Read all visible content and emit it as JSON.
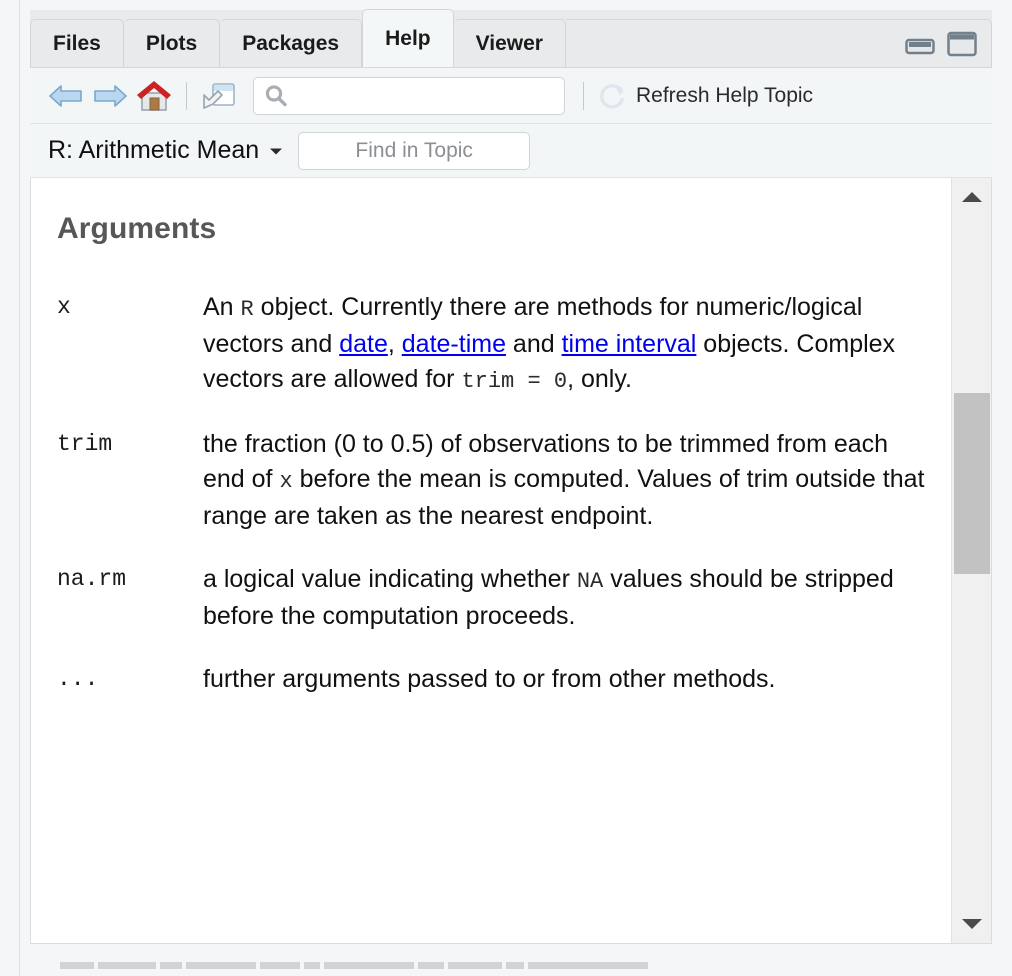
{
  "window": {
    "tabs": [
      {
        "label": "Files",
        "active": false
      },
      {
        "label": "Plots",
        "active": false
      },
      {
        "label": "Packages",
        "active": false
      },
      {
        "label": "Help",
        "active": true
      },
      {
        "label": "Viewer",
        "active": false
      }
    ],
    "controls": {
      "minimize": "minimize-icon",
      "maximize": "maximize-icon"
    }
  },
  "toolbar": {
    "back_icon": "back-arrow-icon",
    "forward_icon": "forward-arrow-icon",
    "home_icon": "home-icon",
    "popout_icon": "show-in-new-window-icon",
    "search": {
      "icon": "search-icon",
      "value": "",
      "placeholder": ""
    },
    "refresh": {
      "icon": "refresh-icon",
      "label": "Refresh Help Topic"
    }
  },
  "topicbar": {
    "title": "R: Arithmetic Mean",
    "caret_icon": "chevron-down-icon",
    "find": {
      "value": "",
      "placeholder": "Find in Topic"
    }
  },
  "content": {
    "heading": "Arguments",
    "arguments": [
      {
        "name": "x",
        "parts": [
          {
            "t": "text",
            "v": "An "
          },
          {
            "t": "code",
            "v": "R"
          },
          {
            "t": "text",
            "v": " object. Currently there are methods for numeric/logical vectors and "
          },
          {
            "t": "link",
            "v": "date"
          },
          {
            "t": "text",
            "v": ", "
          },
          {
            "t": "link",
            "v": "date-time"
          },
          {
            "t": "text",
            "v": " and "
          },
          {
            "t": "link",
            "v": "time interval"
          },
          {
            "t": "text",
            "v": " objects. Complex vectors are allowed for "
          },
          {
            "t": "code",
            "v": "trim = 0"
          },
          {
            "t": "text",
            "v": ", only."
          }
        ]
      },
      {
        "name": "trim",
        "parts": [
          {
            "t": "text",
            "v": "the fraction (0 to 0.5) of observations to be trimmed from each end of "
          },
          {
            "t": "code",
            "v": "x"
          },
          {
            "t": "text",
            "v": " before the mean is computed. Values of trim outside that range are taken as the nearest endpoint."
          }
        ]
      },
      {
        "name": "na.rm",
        "parts": [
          {
            "t": "text",
            "v": "a logical value indicating whether "
          },
          {
            "t": "code",
            "v": "NA"
          },
          {
            "t": "text",
            "v": " values should be stripped before the computation proceeds."
          }
        ]
      },
      {
        "name": "...",
        "parts": [
          {
            "t": "text",
            "v": "further arguments passed to or from other methods."
          }
        ]
      }
    ]
  },
  "scrollbar": {
    "up_icon": "scroll-up-arrow-icon",
    "down_icon": "scroll-down-arrow-icon",
    "thumb_top_pct": 26,
    "thumb_height_pct": 26
  },
  "colors": {
    "link": "#0000ee",
    "heading": "#575757",
    "tab_active_bg": "#f4f7f8",
    "tab_inactive_bg": "#e8eaeb",
    "home_roof": "#cc2222",
    "home_door": "#a97b46",
    "arrow_blue": "#aecfe8",
    "scroll_thumb": "#c2c2c2"
  }
}
